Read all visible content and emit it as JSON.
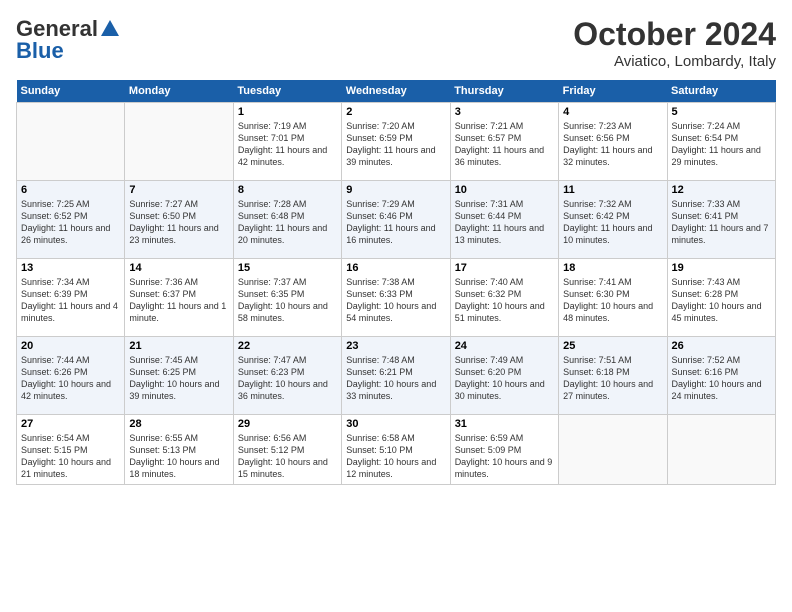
{
  "header": {
    "logo_general": "General",
    "logo_blue": "Blue",
    "month": "October 2024",
    "location": "Aviatico, Lombardy, Italy"
  },
  "weekdays": [
    "Sunday",
    "Monday",
    "Tuesday",
    "Wednesday",
    "Thursday",
    "Friday",
    "Saturday"
  ],
  "weeks": [
    [
      {
        "day": "",
        "sunrise": "",
        "sunset": "",
        "daylight": ""
      },
      {
        "day": "",
        "sunrise": "",
        "sunset": "",
        "daylight": ""
      },
      {
        "day": "1",
        "sunrise": "Sunrise: 7:19 AM",
        "sunset": "Sunset: 7:01 PM",
        "daylight": "Daylight: 11 hours and 42 minutes."
      },
      {
        "day": "2",
        "sunrise": "Sunrise: 7:20 AM",
        "sunset": "Sunset: 6:59 PM",
        "daylight": "Daylight: 11 hours and 39 minutes."
      },
      {
        "day": "3",
        "sunrise": "Sunrise: 7:21 AM",
        "sunset": "Sunset: 6:57 PM",
        "daylight": "Daylight: 11 hours and 36 minutes."
      },
      {
        "day": "4",
        "sunrise": "Sunrise: 7:23 AM",
        "sunset": "Sunset: 6:56 PM",
        "daylight": "Daylight: 11 hours and 32 minutes."
      },
      {
        "day": "5",
        "sunrise": "Sunrise: 7:24 AM",
        "sunset": "Sunset: 6:54 PM",
        "daylight": "Daylight: 11 hours and 29 minutes."
      }
    ],
    [
      {
        "day": "6",
        "sunrise": "Sunrise: 7:25 AM",
        "sunset": "Sunset: 6:52 PM",
        "daylight": "Daylight: 11 hours and 26 minutes."
      },
      {
        "day": "7",
        "sunrise": "Sunrise: 7:27 AM",
        "sunset": "Sunset: 6:50 PM",
        "daylight": "Daylight: 11 hours and 23 minutes."
      },
      {
        "day": "8",
        "sunrise": "Sunrise: 7:28 AM",
        "sunset": "Sunset: 6:48 PM",
        "daylight": "Daylight: 11 hours and 20 minutes."
      },
      {
        "day": "9",
        "sunrise": "Sunrise: 7:29 AM",
        "sunset": "Sunset: 6:46 PM",
        "daylight": "Daylight: 11 hours and 16 minutes."
      },
      {
        "day": "10",
        "sunrise": "Sunrise: 7:31 AM",
        "sunset": "Sunset: 6:44 PM",
        "daylight": "Daylight: 11 hours and 13 minutes."
      },
      {
        "day": "11",
        "sunrise": "Sunrise: 7:32 AM",
        "sunset": "Sunset: 6:42 PM",
        "daylight": "Daylight: 11 hours and 10 minutes."
      },
      {
        "day": "12",
        "sunrise": "Sunrise: 7:33 AM",
        "sunset": "Sunset: 6:41 PM",
        "daylight": "Daylight: 11 hours and 7 minutes."
      }
    ],
    [
      {
        "day": "13",
        "sunrise": "Sunrise: 7:34 AM",
        "sunset": "Sunset: 6:39 PM",
        "daylight": "Daylight: 11 hours and 4 minutes."
      },
      {
        "day": "14",
        "sunrise": "Sunrise: 7:36 AM",
        "sunset": "Sunset: 6:37 PM",
        "daylight": "Daylight: 11 hours and 1 minute."
      },
      {
        "day": "15",
        "sunrise": "Sunrise: 7:37 AM",
        "sunset": "Sunset: 6:35 PM",
        "daylight": "Daylight: 10 hours and 58 minutes."
      },
      {
        "day": "16",
        "sunrise": "Sunrise: 7:38 AM",
        "sunset": "Sunset: 6:33 PM",
        "daylight": "Daylight: 10 hours and 54 minutes."
      },
      {
        "day": "17",
        "sunrise": "Sunrise: 7:40 AM",
        "sunset": "Sunset: 6:32 PM",
        "daylight": "Daylight: 10 hours and 51 minutes."
      },
      {
        "day": "18",
        "sunrise": "Sunrise: 7:41 AM",
        "sunset": "Sunset: 6:30 PM",
        "daylight": "Daylight: 10 hours and 48 minutes."
      },
      {
        "day": "19",
        "sunrise": "Sunrise: 7:43 AM",
        "sunset": "Sunset: 6:28 PM",
        "daylight": "Daylight: 10 hours and 45 minutes."
      }
    ],
    [
      {
        "day": "20",
        "sunrise": "Sunrise: 7:44 AM",
        "sunset": "Sunset: 6:26 PM",
        "daylight": "Daylight: 10 hours and 42 minutes."
      },
      {
        "day": "21",
        "sunrise": "Sunrise: 7:45 AM",
        "sunset": "Sunset: 6:25 PM",
        "daylight": "Daylight: 10 hours and 39 minutes."
      },
      {
        "day": "22",
        "sunrise": "Sunrise: 7:47 AM",
        "sunset": "Sunset: 6:23 PM",
        "daylight": "Daylight: 10 hours and 36 minutes."
      },
      {
        "day": "23",
        "sunrise": "Sunrise: 7:48 AM",
        "sunset": "Sunset: 6:21 PM",
        "daylight": "Daylight: 10 hours and 33 minutes."
      },
      {
        "day": "24",
        "sunrise": "Sunrise: 7:49 AM",
        "sunset": "Sunset: 6:20 PM",
        "daylight": "Daylight: 10 hours and 30 minutes."
      },
      {
        "day": "25",
        "sunrise": "Sunrise: 7:51 AM",
        "sunset": "Sunset: 6:18 PM",
        "daylight": "Daylight: 10 hours and 27 minutes."
      },
      {
        "day": "26",
        "sunrise": "Sunrise: 7:52 AM",
        "sunset": "Sunset: 6:16 PM",
        "daylight": "Daylight: 10 hours and 24 minutes."
      }
    ],
    [
      {
        "day": "27",
        "sunrise": "Sunrise: 6:54 AM",
        "sunset": "Sunset: 5:15 PM",
        "daylight": "Daylight: 10 hours and 21 minutes."
      },
      {
        "day": "28",
        "sunrise": "Sunrise: 6:55 AM",
        "sunset": "Sunset: 5:13 PM",
        "daylight": "Daylight: 10 hours and 18 minutes."
      },
      {
        "day": "29",
        "sunrise": "Sunrise: 6:56 AM",
        "sunset": "Sunset: 5:12 PM",
        "daylight": "Daylight: 10 hours and 15 minutes."
      },
      {
        "day": "30",
        "sunrise": "Sunrise: 6:58 AM",
        "sunset": "Sunset: 5:10 PM",
        "daylight": "Daylight: 10 hours and 12 minutes."
      },
      {
        "day": "31",
        "sunrise": "Sunrise: 6:59 AM",
        "sunset": "Sunset: 5:09 PM",
        "daylight": "Daylight: 10 hours and 9 minutes."
      },
      {
        "day": "",
        "sunrise": "",
        "sunset": "",
        "daylight": ""
      },
      {
        "day": "",
        "sunrise": "",
        "sunset": "",
        "daylight": ""
      }
    ]
  ]
}
